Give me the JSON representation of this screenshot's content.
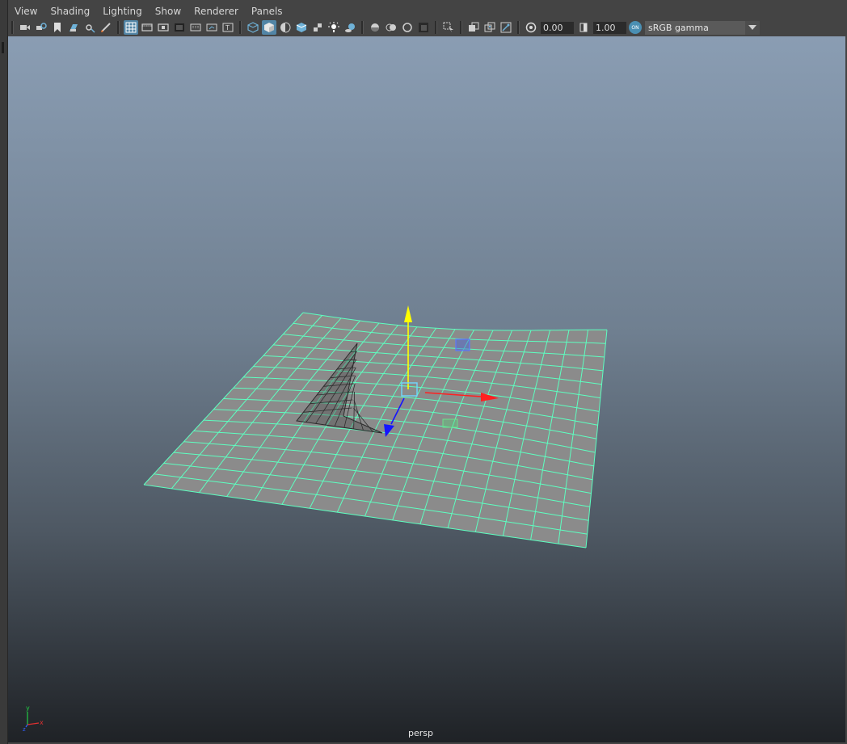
{
  "menubar": {
    "items": [
      "View",
      "Shading",
      "Lighting",
      "Show",
      "Renderer",
      "Panels"
    ]
  },
  "toolbar": {
    "exposure_value": "0.00",
    "gamma_value": "1.00",
    "colormgmt_badge": "ON",
    "color_space": "sRGB gamma",
    "icons": [
      "camera-select-icon",
      "camera-attributes-icon",
      "bookmarks-icon",
      "image-plane-icon",
      "2d-pan-zoom-icon",
      "grease-pencil-icon",
      "grid-icon",
      "film-gate-icon",
      "resolution-gate-icon",
      "gate-mask-icon",
      "field-chart-icon",
      "safe-action-icon",
      "safe-title-icon",
      "wireframe-icon",
      "smooth-shade-icon",
      "default-material-icon",
      "wireframe-on-shaded-icon",
      "textured-icon",
      "use-lights-icon",
      "shadows-icon",
      "screen-space-ao-icon",
      "motion-blur-icon",
      "multisample-aa-icon",
      "depth-of-field-icon",
      "isolate-select-icon",
      "xray-icon",
      "xray-active-components-icon",
      "xray-joints-icon",
      "exposure-icon",
      "gamma-icon",
      "color-management-icon"
    ]
  },
  "viewport": {
    "camera_label": "persp",
    "axis_labels": {
      "x": "x",
      "y": "y",
      "z": "z"
    },
    "colors": {
      "wireframe": "#5dffc0",
      "surface": "#8b8b8b",
      "manip_x": "#ff2020",
      "manip_y": "#ffff00",
      "manip_z": "#1515ff"
    }
  }
}
